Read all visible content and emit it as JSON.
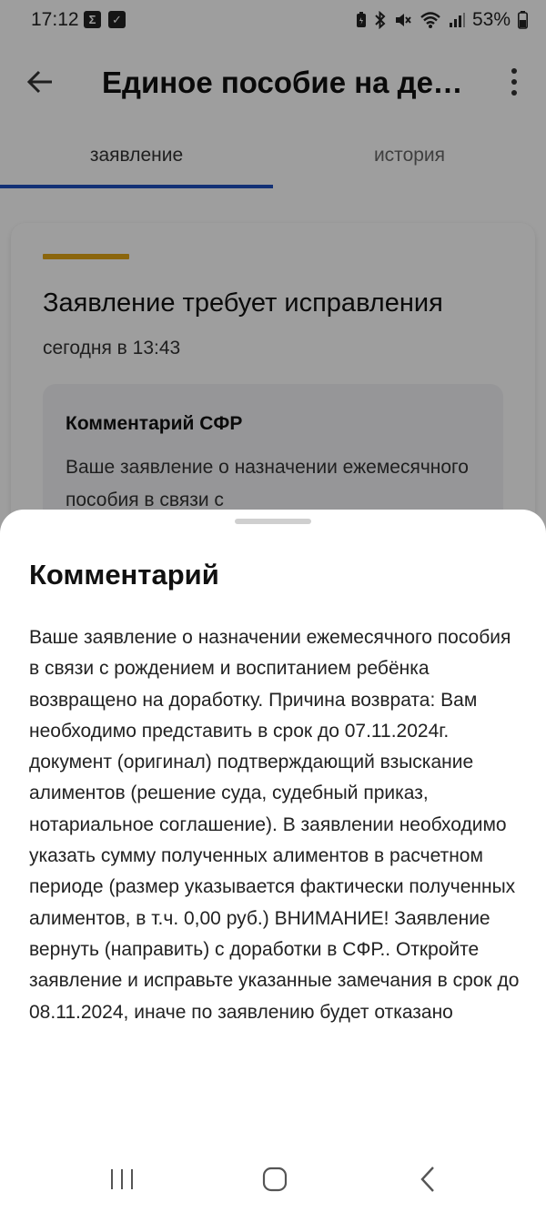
{
  "status_bar": {
    "time": "17:12",
    "notification_icons": [
      "sigma-app-icon",
      "checkbox-app-icon"
    ],
    "battery_percent": "53%",
    "status_icons": [
      "battery-saver-icon",
      "bluetooth-icon",
      "mute-icon",
      "wifi-icon",
      "signal-icon",
      "battery-icon"
    ]
  },
  "app_bar": {
    "title": "Единое пособие на детей",
    "back_icon": "arrow-left-icon",
    "menu_icon": "more-vert-icon"
  },
  "tabs": [
    {
      "label": "заявление",
      "active": true
    },
    {
      "label": "история",
      "active": false
    }
  ],
  "card": {
    "status_title": "Заявление требует исправления",
    "timestamp": "сегодня в 13:43",
    "comment_box_title": "Комментарий СФР",
    "comment_box_text": "Ваше заявление о назначении ежемесячного пособия в связи с"
  },
  "sheet": {
    "title": "Комментарий",
    "text": "Ваше заявление о назначении ежемесячного пособия в связи с рождением и воспитанием ребёнка возвращено на доработку. Причина возврата: Вам необходимо представить в срок до 07.11.2024г. документ (оригинал) подтверждающий взыскание алиментов (решение суда, судебный приказ, нотариальное соглашение). В заявлении необходимо указать сумму полученных алиментов в расчетном периоде (размер указывается фактически полученных алиментов, в т.ч. 0,00 руб.) ВНИМАНИЕ! Заявление вернуть (направить) с доработки в СФР.. Откройте заявление и исправьте указанные замечания в срок до 08.11.2024, иначе по заявлению будет отказано"
  },
  "nav_bar": {
    "buttons": [
      "recents-icon",
      "home-icon",
      "back-icon"
    ]
  },
  "colors": {
    "accent_blue": "#1f4fbf",
    "status_accent": "#e0a516",
    "scrim": "rgba(0,0,0,0.38)"
  }
}
